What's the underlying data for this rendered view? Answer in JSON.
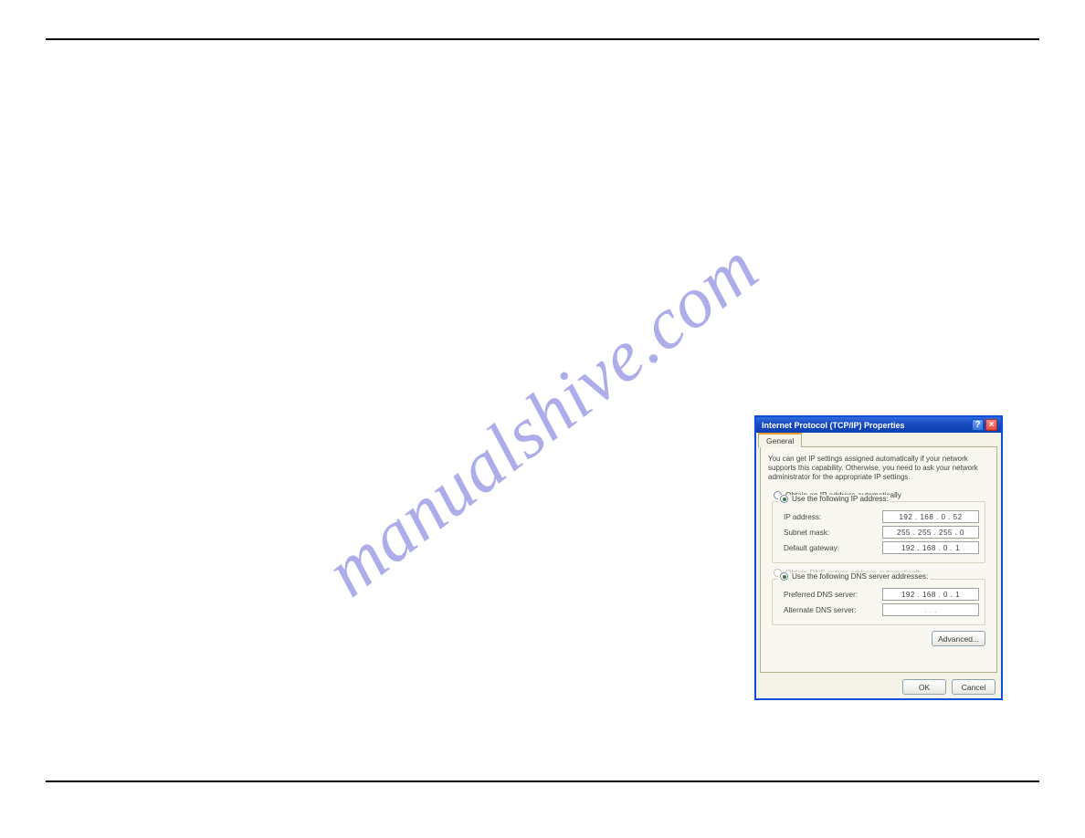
{
  "watermark": "manualshive.com",
  "dialog": {
    "title": "Internet Protocol (TCP/IP) Properties",
    "tab": "General",
    "intro": "You can get IP settings assigned automatically if your network supports this capability. Otherwise, you need to ask your network administrator for the appropriate IP settings.",
    "ip_section": {
      "obtain_auto": "Obtain an IP address automatically",
      "use_following": "Use the following IP address:",
      "ip_label": "IP address:",
      "ip_value": "192 . 168 .  0  .  52",
      "subnet_label": "Subnet mask:",
      "subnet_value": "255 . 255 . 255 .  0",
      "gateway_label": "Default gateway:",
      "gateway_value": "192 . 168 .  0  .  1"
    },
    "dns_section": {
      "obtain_auto": "Obtain DNS server address automatically",
      "use_following": "Use the following DNS server addresses:",
      "preferred_label": "Preferred DNS server:",
      "preferred_value": "192 . 168 .  0  .  1",
      "alternate_label": "Alternate DNS server:",
      "alternate_value": " .       .       . "
    },
    "advanced_btn": "Advanced...",
    "ok_btn": "OK",
    "cancel_btn": "Cancel"
  }
}
